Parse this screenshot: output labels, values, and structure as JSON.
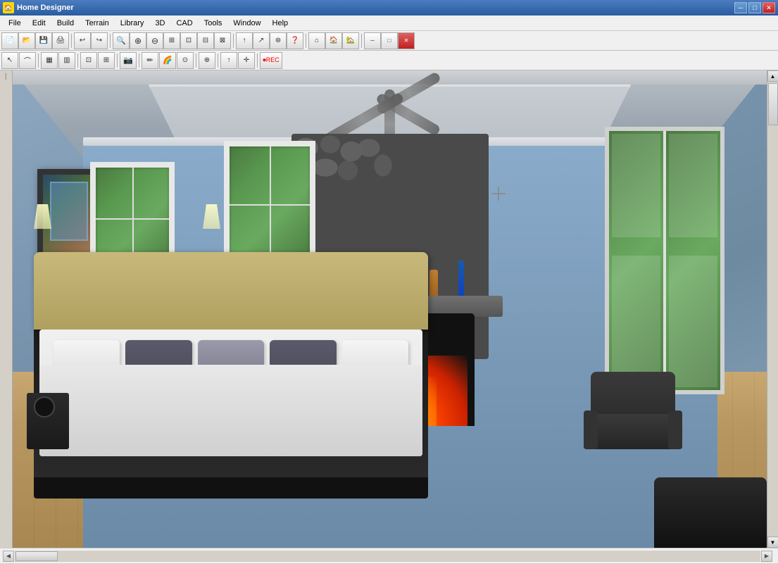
{
  "app": {
    "title": "Home Designer",
    "icon": "🏠"
  },
  "title_bar": {
    "title": "Home Designer",
    "controls": {
      "minimize": "─",
      "maximize": "□",
      "close": "✕"
    },
    "inner_controls": {
      "minimize": "─",
      "maximize": "□",
      "close": "✕"
    }
  },
  "menu": {
    "items": [
      "File",
      "Edit",
      "Build",
      "Terrain",
      "Library",
      "3D",
      "CAD",
      "Tools",
      "Window",
      "Help"
    ]
  },
  "toolbar1": {
    "buttons": [
      {
        "name": "new",
        "icon": "📄"
      },
      {
        "name": "open",
        "icon": "📂"
      },
      {
        "name": "save",
        "icon": "💾"
      },
      {
        "name": "print",
        "icon": "🖨"
      },
      {
        "name": "undo",
        "icon": "↩"
      },
      {
        "name": "redo",
        "icon": "↪"
      },
      {
        "name": "zoom-out-glass",
        "icon": "🔍"
      },
      {
        "name": "zoom-in",
        "icon": "⊕"
      },
      {
        "name": "zoom-out",
        "icon": "⊖"
      },
      {
        "name": "fit-window",
        "icon": "⊞"
      },
      {
        "name": "zoom-region",
        "icon": "⊡"
      },
      {
        "name": "arrow-up",
        "icon": "↑"
      },
      {
        "name": "question",
        "icon": "?"
      },
      {
        "name": "house1",
        "icon": "🏠"
      },
      {
        "name": "house2",
        "icon": "⌂"
      },
      {
        "name": "house3",
        "icon": "🏡"
      }
    ]
  },
  "toolbar2": {
    "buttons": [
      {
        "name": "select",
        "icon": "↖"
      },
      {
        "name": "arc",
        "icon": "⌒"
      },
      {
        "name": "line",
        "icon": "─"
      },
      {
        "name": "wall",
        "icon": "▦"
      },
      {
        "name": "room",
        "icon": "⬜"
      },
      {
        "name": "stair",
        "icon": "⊞"
      },
      {
        "name": "camera",
        "icon": "📷"
      },
      {
        "name": "paint",
        "icon": "🖌"
      },
      {
        "name": "rainbow",
        "icon": "🌈"
      },
      {
        "name": "target",
        "icon": "⊙"
      },
      {
        "name": "pointer",
        "icon": "⊕"
      },
      {
        "name": "arrow-up2",
        "icon": "↑"
      },
      {
        "name": "move",
        "icon": "✛"
      },
      {
        "name": "rec",
        "icon": "⏺"
      }
    ]
  },
  "scene": {
    "type": "3d_bedroom",
    "description": "Bedroom interior with fireplace"
  },
  "status_bar": {
    "text": ""
  }
}
